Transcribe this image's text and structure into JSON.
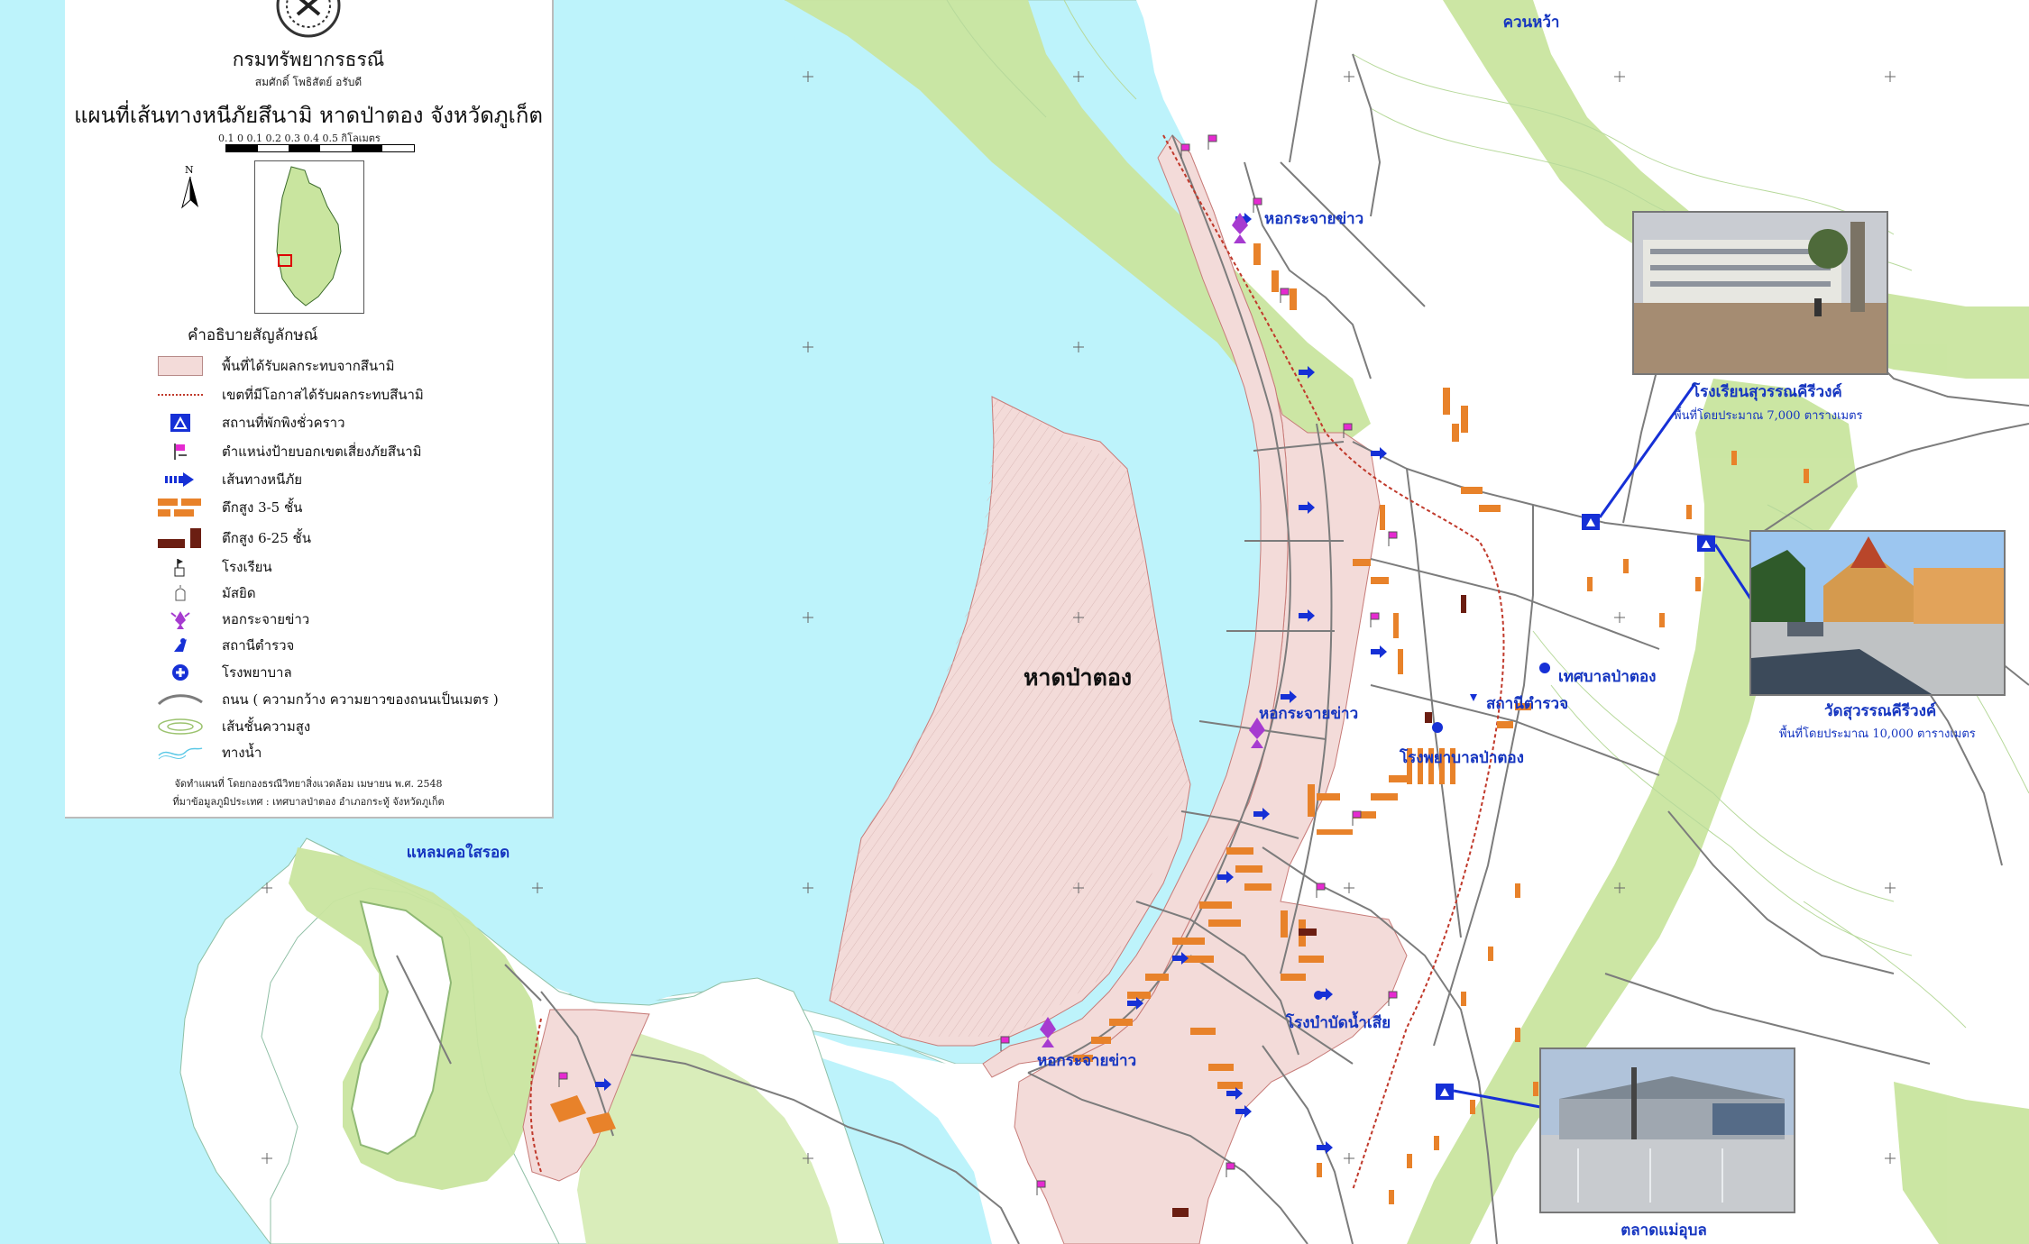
{
  "legend": {
    "department": "กรมทรัพยากรธรณี",
    "authors": "สมศักดิ์ โพธิสัตย์ อรับดี",
    "title": "แผนที่เส้นทางหนีภัยสึนามิ หาดป่าตอง จังหวัดภูเก็ต",
    "scale_numbers": "0.1   0   0.1   0.2   0.3   0.4   0.5  กิโลเมตร",
    "north_label": "N",
    "heading": "คำอธิบายสัญลักษณ์",
    "items": [
      {
        "label": "พื้นที่ได้รับผลกระทบจากสึนามิ",
        "icon": "affected-area-swatch"
      },
      {
        "label": "เขตที่มีโอกาสได้รับผลกระทบสึนามิ",
        "icon": "risk-boundary-line"
      },
      {
        "label": "สถานที่พักพิงชั่วคราว",
        "icon": "shelter-icon"
      },
      {
        "label": "ตำแหน่งป้ายบอกเขตเสี่ยงภัยสึนามิ",
        "icon": "warning-sign-flag-icon"
      },
      {
        "label": "เส้นทางหนีภัย",
        "icon": "evacuation-route-arrow-icon"
      },
      {
        "label": "ตึกสูง 3-5 ชั้น",
        "icon": "building-3-5-icon"
      },
      {
        "label": "ตึกสูง 6-25 ชั้น",
        "icon": "building-6-25-icon"
      },
      {
        "label": "โรงเรียน",
        "icon": "school-icon"
      },
      {
        "label": "มัสยิด",
        "icon": "mosque-icon"
      },
      {
        "label": "หอกระจายข่าว",
        "icon": "broadcast-tower-icon"
      },
      {
        "label": "สถานีตำรวจ",
        "icon": "police-station-icon"
      },
      {
        "label": "โรงพยาบาล",
        "icon": "hospital-icon"
      },
      {
        "label": "ถนน ( ความกว้าง ความยาวของถนนเป็นเมตร )",
        "icon": "road-symbol"
      },
      {
        "label": "เส้นชั้นความสูง",
        "icon": "contour-symbol"
      },
      {
        "label": "ทางน้ำ",
        "icon": "waterway-symbol"
      }
    ],
    "credit_1": "จัดทำแผนที่ โดยกองธรณีวิทยาสิ่งแวดล้อม เมษายน พ.ศ. 2548",
    "credit_2": "ที่มาข้อมูลภูมิประเทศ : เทศบาลป่าตอง อำเภอกระทู้ จังหวัดภูเก็ต"
  },
  "map_labels": {
    "beach": "หาดป่าตอง",
    "kwan_wa": "ควนหว้า",
    "cape": "แหลมคอใสรอด",
    "tower_1": "หอกระจายข่าว",
    "tower_2": "หอกระจายข่าว",
    "tower_3": "หอกระจายข่าว",
    "municipality": "เทศบาลป่าตอง",
    "police": "สถานีตำรวจ",
    "hospital": "โรงพยาบาลป่าตอง",
    "water_treatment": "โรงบำบัดน้ำเสีย",
    "school": "โรงเรียนสุวรรณคีรีวงค์",
    "school_area": "พื้นที่โดยประมาณ 7,000 ตารางเมตร",
    "temple": "วัดสุวรรณคีรีวงค์",
    "temple_area": "พื้นที่โดยประมาณ 10,000 ตารางเมตร",
    "market": "ตลาดแม่อุบล"
  },
  "colors": {
    "sea": "#bdf3fb",
    "land": "#ffffff",
    "vegetation": "#c9e59f",
    "affected_area": "#f3dbd9",
    "building_low": "#e8822a",
    "building_high": "#6b1e12",
    "shelter": "#1630d6",
    "warning_flag": "#e52ad0",
    "tower": "#a63bd0",
    "label_blue": "#1535c0"
  }
}
